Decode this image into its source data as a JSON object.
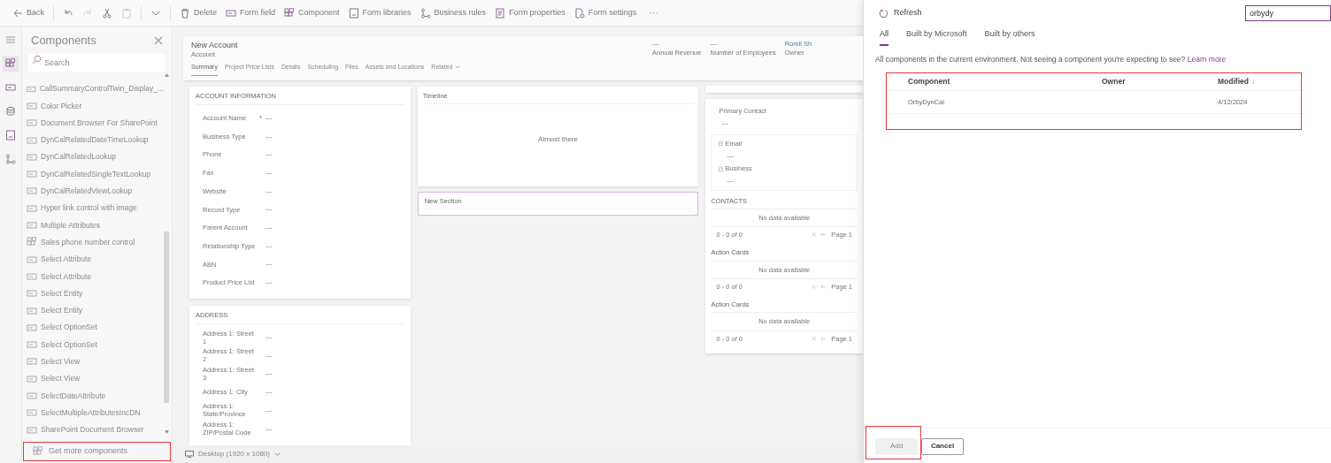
{
  "toolbar": [
    {
      "kind": "back",
      "label": "Back"
    },
    {
      "kind": "undo",
      "disabled": false
    },
    {
      "kind": "redo",
      "disabled": true
    },
    {
      "kind": "cut",
      "disabled": false
    },
    {
      "kind": "paste",
      "disabled": true
    },
    {
      "kind": "split"
    },
    {
      "kind": "delete",
      "label": "Delete"
    },
    {
      "kind": "field",
      "label": "Form field"
    },
    {
      "kind": "component",
      "label": "Component"
    },
    {
      "kind": "libraries",
      "label": "Form libraries"
    },
    {
      "kind": "rules",
      "label": "Business rules"
    },
    {
      "kind": "properties",
      "label": "Form properties"
    },
    {
      "kind": "settings",
      "label": "Form settings"
    },
    {
      "kind": "more",
      "label": "···"
    }
  ],
  "rail": [
    {
      "kind": "menu",
      "selected": false
    },
    {
      "kind": "component",
      "selected": true
    },
    {
      "kind": "field",
      "selected": false
    },
    {
      "kind": "tables",
      "selected": false
    },
    {
      "kind": "libraries",
      "selected": false
    },
    {
      "kind": "rules",
      "selected": false
    }
  ],
  "components_panel": {
    "title": "Components",
    "search": {
      "placeholder": "Search"
    },
    "items": [
      {
        "kind": "field",
        "label": "CallSummaryControlTwin_Display_..."
      },
      {
        "kind": "field",
        "label": "Color Picker"
      },
      {
        "kind": "field",
        "label": "Document Browser For SharePoint"
      },
      {
        "kind": "field",
        "label": "DynCalRelatedDateTimeLookup"
      },
      {
        "kind": "field",
        "label": "DynCalRelatedLookup"
      },
      {
        "kind": "field",
        "label": "DynCalRelatedSingleTextLookup"
      },
      {
        "kind": "field",
        "label": "DynCalRelatedViewLookup"
      },
      {
        "kind": "field",
        "label": "Hyper link control with image"
      },
      {
        "kind": "field",
        "label": "Multiple Attributes"
      },
      {
        "kind": "component",
        "label": "Sales phone number control"
      },
      {
        "kind": "field",
        "label": "Select Attribute"
      },
      {
        "kind": "field",
        "label": "Select Attribute"
      },
      {
        "kind": "field",
        "label": "Select Entity"
      },
      {
        "kind": "field",
        "label": "Select Entity"
      },
      {
        "kind": "field",
        "label": "Select OptionSet"
      },
      {
        "kind": "field",
        "label": "Select OptionSet"
      },
      {
        "kind": "field",
        "label": "Select View"
      },
      {
        "kind": "field",
        "label": "Select View"
      },
      {
        "kind": "field",
        "label": "SelectDateAttribute"
      },
      {
        "kind": "field",
        "label": "SelectMultipleAttributesIncDN"
      },
      {
        "kind": "field",
        "label": "SharePoint Document Browser"
      }
    ],
    "action": "Get more components"
  },
  "form": {
    "title": "New Account",
    "subtitle": "Account",
    "header_fields": [
      {
        "value": "---",
        "label": "Annual Revenue"
      },
      {
        "value": "---",
        "label": "Number of Employees"
      },
      {
        "value": "Romil Sh",
        "label": "Owner"
      }
    ],
    "tabs": [
      {
        "kind": "tab",
        "label": "Summary",
        "selected": true
      },
      {
        "kind": "tab",
        "label": "Project Price Lists",
        "selected": false
      },
      {
        "kind": "tab",
        "label": "Details",
        "selected": false
      },
      {
        "kind": "tab",
        "label": "Scheduling",
        "selected": false
      },
      {
        "kind": "tab",
        "label": "Files",
        "selected": false
      },
      {
        "kind": "tab",
        "label": "Assets and Locations",
        "selected": false
      },
      {
        "kind": "dropdown",
        "label": "Related",
        "selected": false
      }
    ],
    "sections": [
      {
        "title": "ACCOUNT INFORMATION",
        "fields": [
          {
            "label": "Account Name",
            "required_mark": "*",
            "value": "---"
          },
          {
            "label": "Business Type",
            "value": "---"
          },
          {
            "label": "Phone",
            "value": "---"
          },
          {
            "label": "Fax",
            "value": "---"
          },
          {
            "label": "Website",
            "value": "---"
          },
          {
            "label": "Record Type",
            "value": "---"
          },
          {
            "label": "Parent Account",
            "value": "---"
          },
          {
            "label": "Relationship Type",
            "value": "---"
          },
          {
            "label": "ABN",
            "value": "---"
          },
          {
            "label": "Product Price List",
            "value": "---"
          }
        ]
      },
      {
        "title": "ADDRESS",
        "fields": [
          {
            "label": "Address 1: Street 1",
            "value": "---"
          },
          {
            "label": "Address 1: Street 2",
            "value": "---"
          },
          {
            "label": "Address 1: Street 3",
            "value": "---"
          },
          {
            "label": "Address 1: City",
            "value": "---"
          },
          {
            "label": "Address 1: State/Province",
            "value": "---"
          },
          {
            "label": "Address 1: ZIP/Postal Code",
            "value": "---"
          }
        ]
      }
    ],
    "timeline": {
      "title": "Timeline",
      "message": "Almost there"
    },
    "new_section": {
      "title": "New Section",
      "selected": true
    },
    "primary_contact": {
      "label": "Primary Contact",
      "value": "---"
    },
    "quick_view": [
      {
        "label": "Email",
        "value": "---",
        "locked": true
      },
      {
        "label": "Business",
        "value": "---",
        "locked": true
      }
    ],
    "grids": [
      {
        "title": "CONTACTS",
        "message": "No data available",
        "range": "0 - 0 of 0",
        "page": "Page 1"
      },
      {
        "title": "Action Cards",
        "message": "No data available",
        "range": "0 - 0 of 0",
        "page": "Page 1"
      },
      {
        "title": "Action Cards",
        "message": "No data available",
        "range": "0 - 0 of 0",
        "page": "Page 1"
      }
    ],
    "viewport": "Desktop (1920 x 1080)"
  },
  "panel": {
    "refresh": "Refresh",
    "search": {
      "value": "orbydy"
    },
    "tabs": [
      {
        "label": "All",
        "selected": true
      },
      {
        "label": "Built by Microsoft",
        "selected": false
      },
      {
        "label": "Built by others",
        "selected": false
      }
    ],
    "description": {
      "text": "All components in the current environment. Not seeing a component you're expecting to see?",
      "link": "Learn more"
    },
    "table": {
      "columns": [
        {
          "label": "Component"
        },
        {
          "label": "Owner"
        },
        {
          "label": "Modified",
          "sort_arrow": "↓"
        }
      ],
      "rows": [
        {
          "component": "OrbyDynCal",
          "modified": "4/12/2024"
        }
      ]
    },
    "buttons": [
      {
        "label": "Add",
        "disabled": true
      },
      {
        "label": "Cancel",
        "disabled": false
      }
    ]
  }
}
